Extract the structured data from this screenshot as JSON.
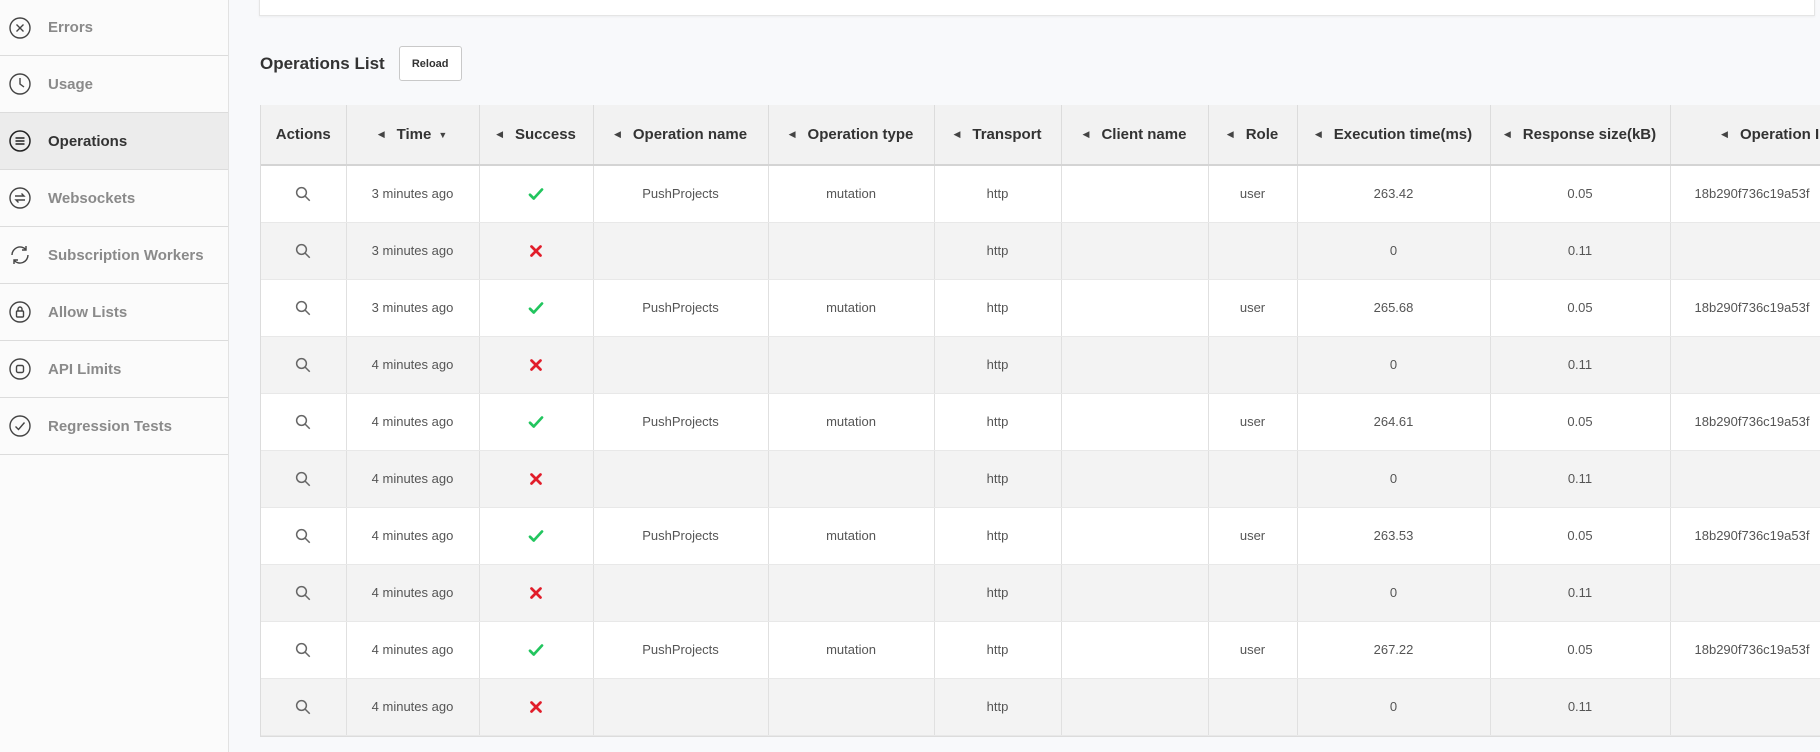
{
  "sidebar": {
    "items": [
      {
        "label": "Errors",
        "icon": "close-circle-icon",
        "active": false
      },
      {
        "label": "Usage",
        "icon": "clock-icon",
        "active": false
      },
      {
        "label": "Operations",
        "icon": "list-circle-icon",
        "active": true
      },
      {
        "label": "Websockets",
        "icon": "swap-circle-icon",
        "active": false
      },
      {
        "label": "Subscription Workers",
        "icon": "refresh-icon",
        "active": false
      },
      {
        "label": "Allow Lists",
        "icon": "lock-circle-icon",
        "active": false
      },
      {
        "label": "API Limits",
        "icon": "stop-circle-icon",
        "active": false
      },
      {
        "label": "Regression Tests",
        "icon": "check-circle-icon",
        "active": false
      }
    ]
  },
  "operations": {
    "title": "Operations List",
    "reload_label": "Reload"
  },
  "table": {
    "columns": [
      "Actions",
      "Time",
      "Success",
      "Operation name",
      "Operation type",
      "Transport",
      "Client name",
      "Role",
      "Execution time(ms)",
      "Response size(kB)",
      "Operation ID"
    ],
    "sort_column": "Time",
    "sort_direction": "descending",
    "rows": [
      {
        "time": "3 minutes ago",
        "success": true,
        "operation_name": "PushProjects",
        "operation_type": "mutation",
        "transport": "http",
        "client_name": "",
        "role": "user",
        "execution_time": "263.42",
        "response_size": "0.05",
        "operation_id": "18b290f736c19a53f"
      },
      {
        "time": "3 minutes ago",
        "success": false,
        "operation_name": "",
        "operation_type": "",
        "transport": "http",
        "client_name": "",
        "role": "",
        "execution_time": "0",
        "response_size": "0.11",
        "operation_id": ""
      },
      {
        "time": "3 minutes ago",
        "success": true,
        "operation_name": "PushProjects",
        "operation_type": "mutation",
        "transport": "http",
        "client_name": "",
        "role": "user",
        "execution_time": "265.68",
        "response_size": "0.05",
        "operation_id": "18b290f736c19a53f"
      },
      {
        "time": "4 minutes ago",
        "success": false,
        "operation_name": "",
        "operation_type": "",
        "transport": "http",
        "client_name": "",
        "role": "",
        "execution_time": "0",
        "response_size": "0.11",
        "operation_id": ""
      },
      {
        "time": "4 minutes ago",
        "success": true,
        "operation_name": "PushProjects",
        "operation_type": "mutation",
        "transport": "http",
        "client_name": "",
        "role": "user",
        "execution_time": "264.61",
        "response_size": "0.05",
        "operation_id": "18b290f736c19a53f"
      },
      {
        "time": "4 minutes ago",
        "success": false,
        "operation_name": "",
        "operation_type": "",
        "transport": "http",
        "client_name": "",
        "role": "",
        "execution_time": "0",
        "response_size": "0.11",
        "operation_id": ""
      },
      {
        "time": "4 minutes ago",
        "success": true,
        "operation_name": "PushProjects",
        "operation_type": "mutation",
        "transport": "http",
        "client_name": "",
        "role": "user",
        "execution_time": "263.53",
        "response_size": "0.05",
        "operation_id": "18b290f736c19a53f"
      },
      {
        "time": "4 minutes ago",
        "success": false,
        "operation_name": "",
        "operation_type": "",
        "transport": "http",
        "client_name": "",
        "role": "",
        "execution_time": "0",
        "response_size": "0.11",
        "operation_id": ""
      },
      {
        "time": "4 minutes ago",
        "success": true,
        "operation_name": "PushProjects",
        "operation_type": "mutation",
        "transport": "http",
        "client_name": "",
        "role": "user",
        "execution_time": "267.22",
        "response_size": "0.05",
        "operation_id": "18b290f736c19a53f"
      },
      {
        "time": "4 minutes ago",
        "success": false,
        "operation_name": "",
        "operation_type": "",
        "transport": "http",
        "client_name": "",
        "role": "",
        "execution_time": "0",
        "response_size": "0.11",
        "operation_id": ""
      }
    ]
  },
  "colors": {
    "success": "#22c55e",
    "failure": "#e11d2a",
    "active_nav": "#ececec"
  }
}
